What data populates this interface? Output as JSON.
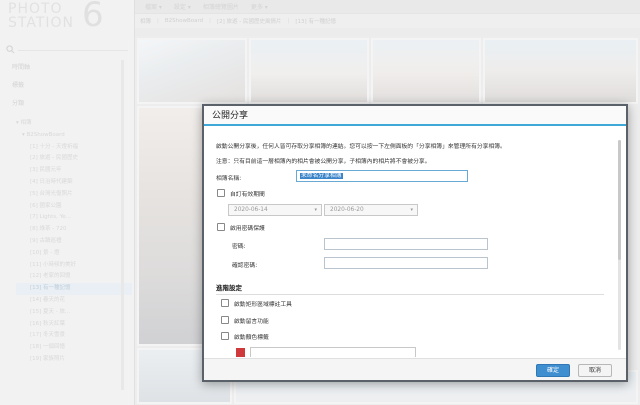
{
  "app": {
    "logo_line1": "PHOTO",
    "logo_line2": "STATION",
    "logo_version": "6",
    "side_links": [
      "時間軸",
      "標籤",
      "分類"
    ],
    "topbar": [
      "檔案 ▾",
      "設定 ▾",
      "相簿總覽圖片",
      "更多 ▾"
    ],
    "breadcrumbs": [
      "相簿",
      "B2ShowBoard",
      "[2] 旅遊 - 民國歷史風情片",
      "[13] 有一種記憶"
    ],
    "tree_root": "▾ 相簿",
    "tree_sub": "▾ B2ShowBoard",
    "tree_items": [
      "[1] 十分 - 天燈祈福",
      "[2] 旅遊 - 民國歷史",
      "[3] 民國元年",
      "[4] 日治時代建築",
      "[5] 台灣光復照片",
      "[6] 國家公園",
      "[7] Lights, Ye...",
      "[8] 綠茶 - 720",
      "[9] 古蹟巡禮",
      "[10] 景 - 燈",
      "[11] 小時候的美好",
      "[12] 老家的回憶",
      "[13] 有一種記憶",
      "[14] 春天的花",
      "[15] 夏天 - 旅...",
      "[16] 秋天紅葉",
      "[17] 冬天雪景",
      "[18] 一個回憶",
      "[19] 家族照片"
    ]
  },
  "dialog": {
    "title": "公開分享",
    "intro": "啟動公開分享後，任何人皆可存取分享相簿的連結。您可以按一下左側面板的「分享相簿」來管理所有分享相簿。",
    "note": "注意：只有目前這一層相簿內的相片會被公開分享，子相簿內的相片將不會被分享。",
    "album_name_label": "相簿名稱:",
    "album_name_value": "未命名分享相簿",
    "validity_label": "自訂有效期間",
    "date_start": "2020-06-14",
    "date_end": "2020-06-20",
    "password_label": "啟用密碼保護",
    "password_field_label": "密碼:",
    "confirm_password_label": "確認密碼:",
    "advanced_heading": "進階設定",
    "opt_region_tag": "啟動矩形區域標註工具",
    "opt_comment": "啟動留言功能",
    "opt_color_tag": "啟動顏色標籤",
    "ok_label": "確定",
    "cancel_label": "取消",
    "accent_color": "#3fa8d9",
    "button_color": "#3e8ed0",
    "tag_swatch_color": "#d0393b"
  }
}
